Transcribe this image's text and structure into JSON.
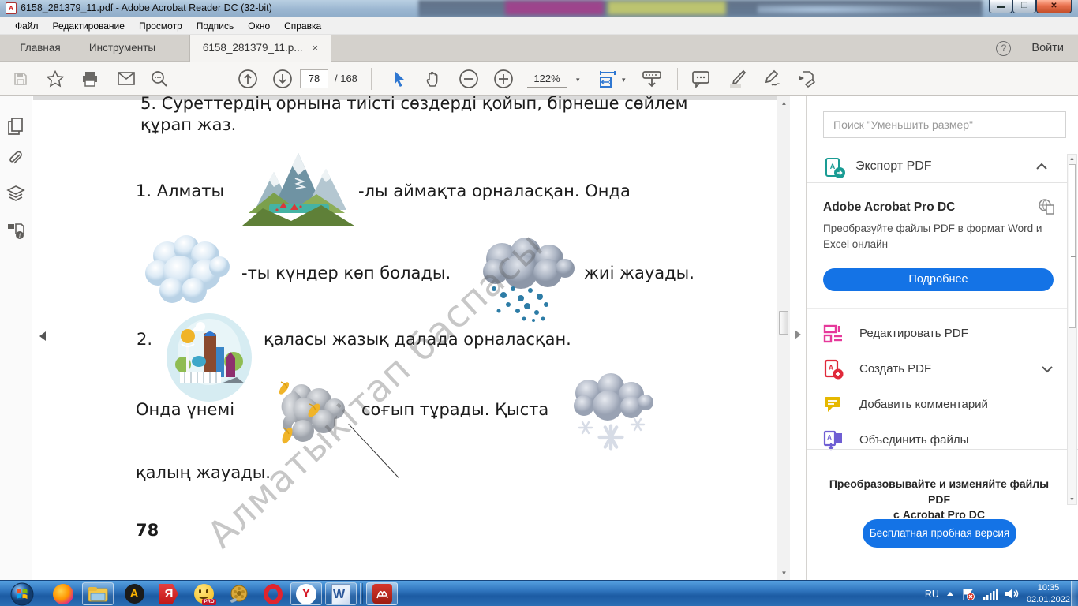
{
  "window": {
    "title": "6158_281379_11.pdf - Adobe Acrobat Reader DC (32-bit)",
    "pdf_badge": "A"
  },
  "menu": {
    "items": [
      {
        "label": "Файл"
      },
      {
        "label": "Редактирование"
      },
      {
        "label": "Просмотр"
      },
      {
        "label": "Подпись"
      },
      {
        "label": "Окно"
      },
      {
        "label": "Справка"
      }
    ]
  },
  "tabs": {
    "home": "Главная",
    "tools": "Инструменты",
    "doc": "6158_281379_11.p...",
    "close": "×"
  },
  "signin": {
    "help": "?",
    "label": "Войти"
  },
  "toolbar": {
    "page": "78",
    "page_total": "/ 168",
    "zoom": "122%",
    "caret": "▾"
  },
  "sidebar": {
    "search_placeholder": "Поиск \"Уменьшить размер\"",
    "export_label": "Экспорт PDF",
    "promo": {
      "title": "Adobe Acrobat Pro DC",
      "body": "Преобразуйте файлы PDF в формат Word и Excel онлайн",
      "button": "Подробнее"
    },
    "tools": [
      {
        "label": "Редактировать PDF"
      },
      {
        "label": "Создать PDF"
      },
      {
        "label": "Добавить комментарий"
      },
      {
        "label": "Объединить файлы"
      }
    ],
    "footer": {
      "title_line1": "Преобразовывайте и изменяйте файлы PDF",
      "title_line2": "с Acrobat Pro DC",
      "button": "Бесплатная пробная версия"
    }
  },
  "document": {
    "heading_line1": "5. Суреттердің орнына тиісті сөздерді қойып, бірнеше сөйлем",
    "heading_line2": "құрап жаз.",
    "s1_prefix": "1. Алматы",
    "s1_suffix": "-лы аймақта орналасқан. Онда",
    "s2_cloud_suffix": "-ты күндер көп болады.",
    "s2_rain_suffix": "жиі жауады.",
    "s3_num": "2.",
    "s3_text": "қаласы жазық далада орналасқан.",
    "s4_prefix": "Онда үнемі",
    "s4_mid": "соғып тұрады. Қыста",
    "s5": "қалың жауады.",
    "page_number": "78",
    "watermark": "Алматыкітап баспасы",
    "images": [
      "mountains",
      "clouds",
      "rain-cloud",
      "city",
      "wind-with-leaves",
      "snow-cloud"
    ]
  },
  "taskbar": {
    "lang": "RU",
    "time": "10:35",
    "date": "02.01.2022"
  },
  "icons": {
    "titlebar": [
      "pdf-file-icon",
      "minimize-icon",
      "restore-icon",
      "close-icon"
    ],
    "toolbar": [
      "save-icon",
      "star-icon",
      "print-icon",
      "email-icon",
      "search-icon",
      "page-up-icon",
      "page-down-icon",
      "pointer-icon",
      "hand-icon",
      "zoom-out-icon",
      "zoom-in-icon",
      "fit-width-icon",
      "reading-mode-icon",
      "comment-icon",
      "highlighter-icon",
      "sign-icon",
      "send-icon"
    ],
    "left_strip": [
      "thumbnails-icon",
      "attachment-icon",
      "layers-icon",
      "doc-info-icon"
    ],
    "sidebar": [
      "export-pdf-icon",
      "word-convert-icon",
      "edit-pdf-icon",
      "create-pdf-icon",
      "add-comment-icon",
      "combine-files-icon"
    ],
    "taskbar": [
      "start-icon",
      "firefox-icon",
      "explorer-icon",
      "aimp-icon",
      "yandex-alpha-icon",
      "fraps-icon",
      "media-player-icon",
      "opera-icon",
      "yandex-browser-icon",
      "word-icon",
      "acrobat-icon",
      "tray-up-icon",
      "action-center-icon",
      "network-icon",
      "volume-icon"
    ]
  },
  "colors": {
    "accent": "#1473e6",
    "taskbar_blue": "#2f74bd",
    "close_button": "#e86f4c",
    "edit_pdf": "#e6399b",
    "create_pdf": "#e0293a",
    "comment_yellow": "#e6b800",
    "combine_purple": "#6f5ed3"
  }
}
